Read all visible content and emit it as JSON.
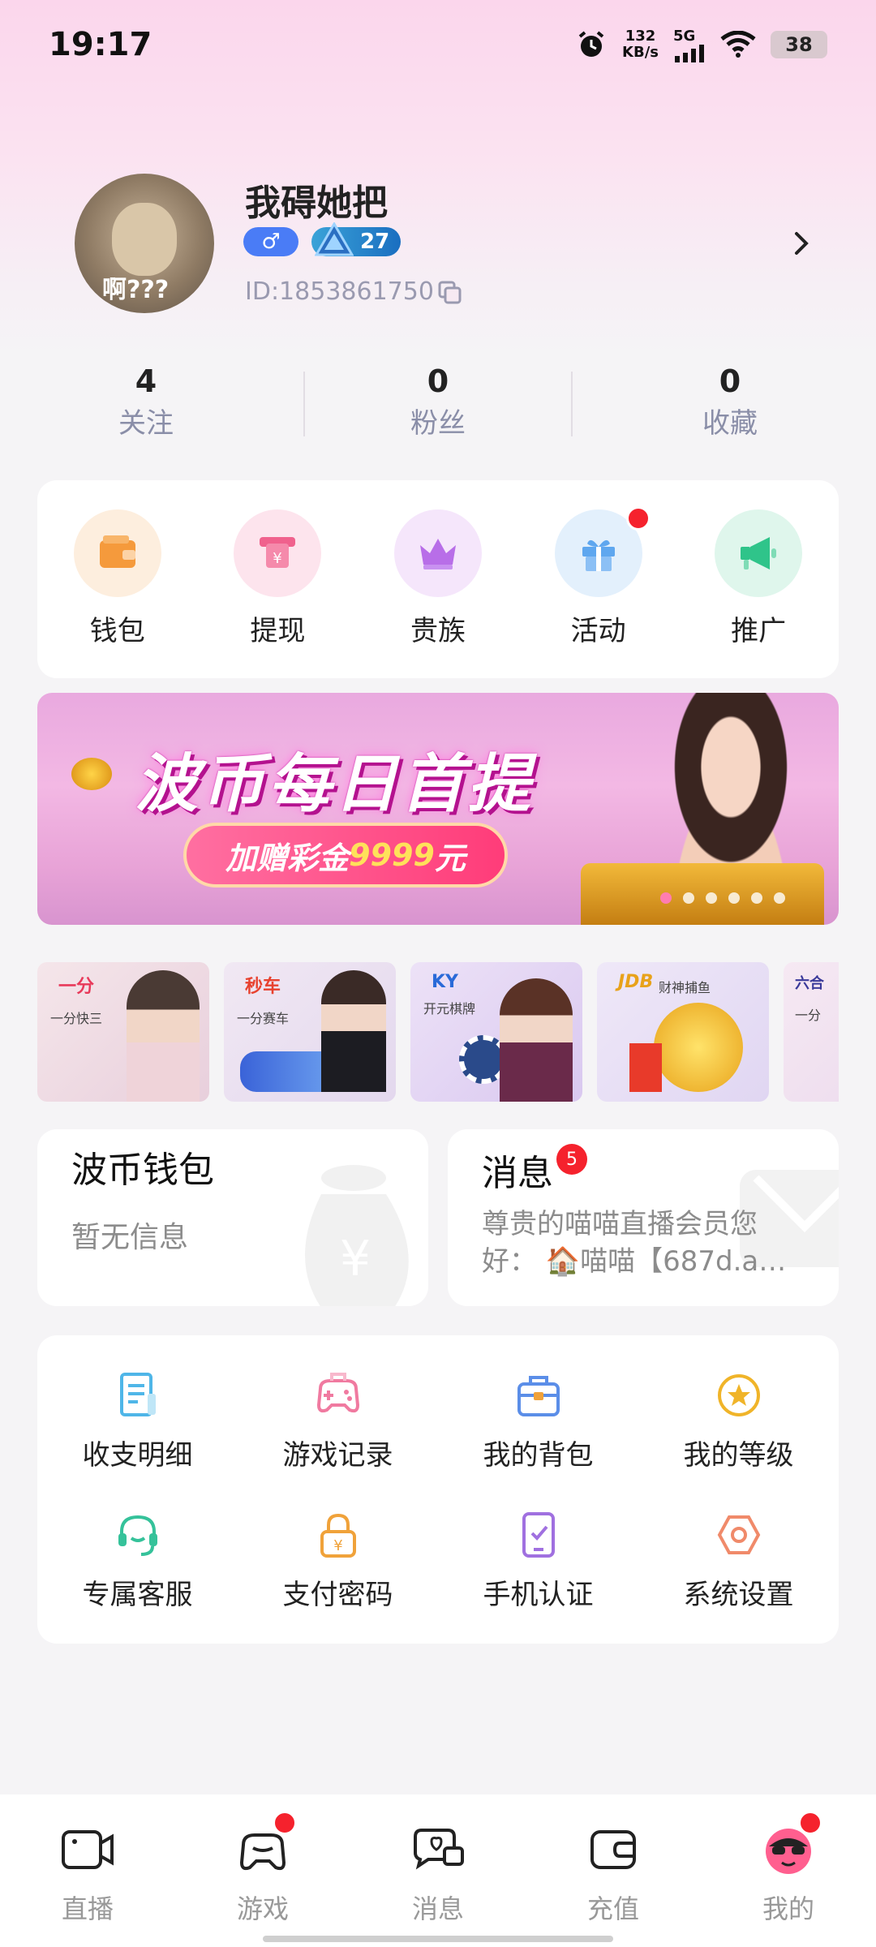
{
  "status_bar": {
    "time": "19:17",
    "net_speed": "132",
    "net_unit": "KB/s",
    "network": "5G",
    "battery": "38"
  },
  "profile": {
    "nickname": "我碍她把",
    "gender_symbol": "♂",
    "level": "27",
    "user_id": "ID:1853861750",
    "avatar_caption": "啊???"
  },
  "stats": [
    {
      "value": "4",
      "label": "关注"
    },
    {
      "value": "0",
      "label": "粉丝"
    },
    {
      "value": "0",
      "label": "收藏"
    }
  ],
  "quick_menu": [
    {
      "label": "钱包",
      "icon": "wallet-icon",
      "color": "#f59a3c",
      "bg": "#fdeede"
    },
    {
      "label": "提现",
      "icon": "withdraw-icon",
      "color": "#f0618d",
      "bg": "#fde4ed"
    },
    {
      "label": "贵族",
      "icon": "crown-icon",
      "color": "#b86ee8",
      "bg": "#f5e6fb"
    },
    {
      "label": "活动",
      "icon": "gift-icon",
      "color": "#5fa7ef",
      "bg": "#e3f0fc"
    },
    {
      "label": "推广",
      "icon": "megaphone-icon",
      "color": "#2fc48a",
      "bg": "#dff6ec"
    }
  ],
  "banner": {
    "title": "波币每日首提",
    "pill_prefix": "加赠彩金",
    "pill_amount": "9999",
    "pill_suffix": "元"
  },
  "games": [
    {
      "logo": "一分",
      "tag": "一分快三",
      "color": "#f3e6ea"
    },
    {
      "logo": "秒车",
      "tag": "一分赛车",
      "color": "#efe8f4"
    },
    {
      "logo": "KY",
      "tag": "开元棋牌",
      "color": "#e9e0f5"
    },
    {
      "logo": "JDB",
      "tag": "财神捕鱼",
      "color": "#ece6f6"
    },
    {
      "logo": "六合",
      "tag": "一分",
      "color": "#f4e7f1"
    }
  ],
  "wallet": {
    "title": "波币钱包",
    "subtitle": "暂无信息"
  },
  "messages": {
    "title": "消息",
    "badge": "5",
    "preview": "尊贵的喵喵直播会员您好： 🏠喵喵【687d.a…"
  },
  "features": [
    {
      "label": "收支明细",
      "icon": "ledger-icon",
      "color": "#4fb6e8"
    },
    {
      "label": "游戏记录",
      "icon": "gamepad-icon",
      "color": "#f07aa0"
    },
    {
      "label": "我的背包",
      "icon": "backpack-icon",
      "color": "#5b8ee8"
    },
    {
      "label": "我的等级",
      "icon": "level-star-icon",
      "color": "#f0b429"
    },
    {
      "label": "专属客服",
      "icon": "headset-icon",
      "color": "#35c29a"
    },
    {
      "label": "支付密码",
      "icon": "lock-icon",
      "color": "#f0a23a"
    },
    {
      "label": "手机认证",
      "icon": "phone-verify-icon",
      "color": "#a070e0"
    },
    {
      "label": "系统设置",
      "icon": "settings-icon",
      "color": "#f08a6a"
    }
  ],
  "nav": [
    {
      "label": "直播",
      "icon": "live-icon"
    },
    {
      "label": "游戏",
      "icon": "game-icon"
    },
    {
      "label": "消息",
      "icon": "message-icon"
    },
    {
      "label": "充值",
      "icon": "recharge-icon"
    },
    {
      "label": "我的",
      "icon": "me-icon"
    }
  ]
}
